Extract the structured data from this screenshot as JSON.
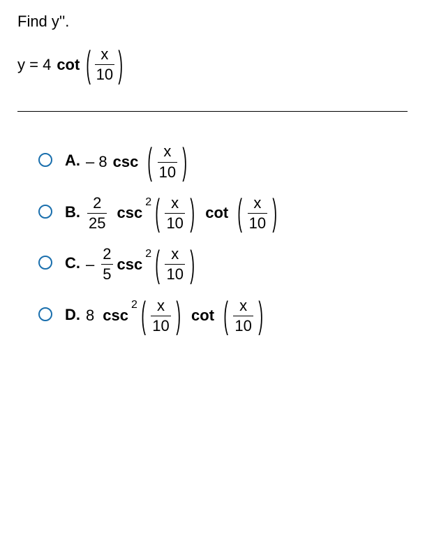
{
  "question": {
    "prompt": "Find y''.",
    "equation_lhs": "y = 4",
    "cot": "cot",
    "arg_num": "x",
    "arg_den": "10"
  },
  "choices": {
    "A": {
      "letter": "A.",
      "neg": "– 8",
      "csc": "csc",
      "arg_num": "x",
      "arg_den": "10"
    },
    "B": {
      "letter": "B.",
      "frac_num": "2",
      "frac_den": "25",
      "csc": "csc",
      "exp": "2",
      "arg1_num": "x",
      "arg1_den": "10",
      "cot": "cot",
      "arg2_num": "x",
      "arg2_den": "10"
    },
    "C": {
      "letter": "C.",
      "neg": "–",
      "frac_num": "2",
      "frac_den": "5",
      "csc": "csc",
      "exp": "2",
      "arg_num": "x",
      "arg_den": "10"
    },
    "D": {
      "letter": "D.",
      "coef": "8",
      "csc": "csc",
      "exp": "2",
      "arg1_num": "x",
      "arg1_den": "10",
      "cot": "cot",
      "arg2_num": "x",
      "arg2_den": "10"
    }
  }
}
